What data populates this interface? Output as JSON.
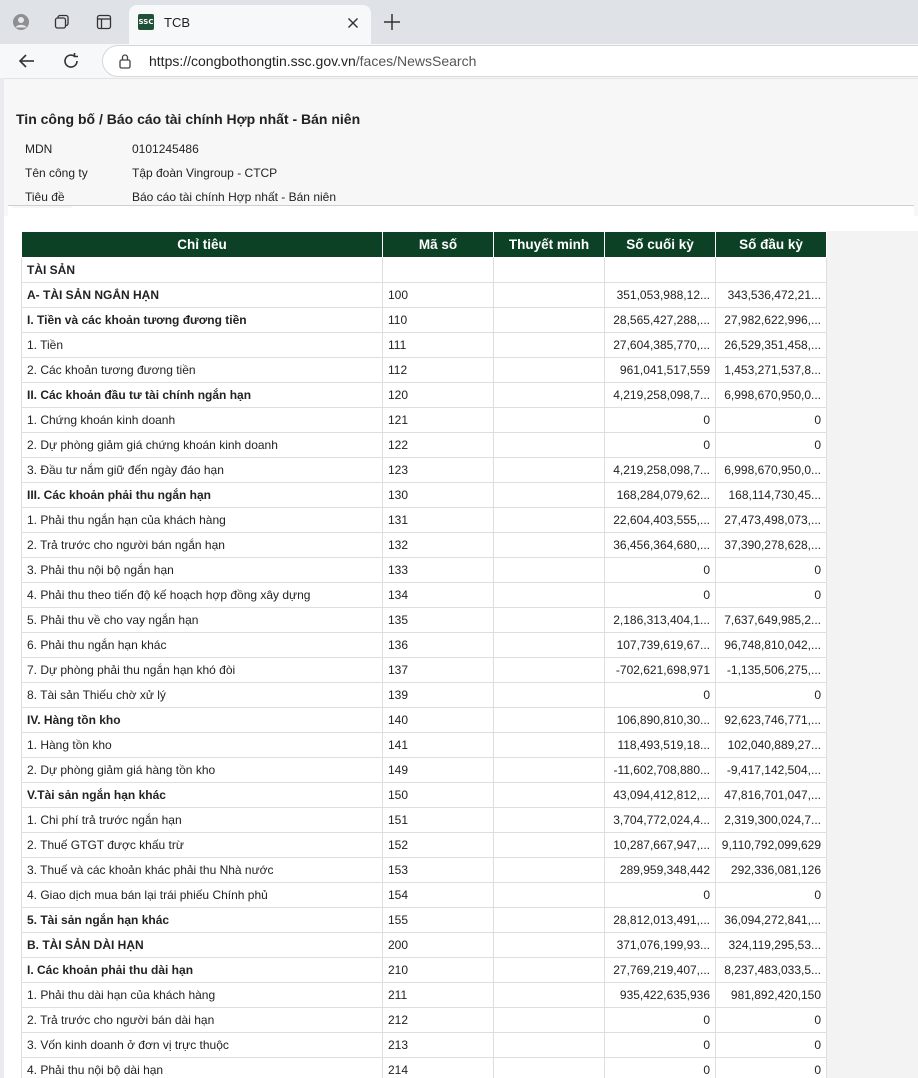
{
  "browser": {
    "tab_title": "TCB",
    "favicon_text": "SSC",
    "url_host": "https://congbothongtin.ssc.gov.vn",
    "url_path": "/faces/NewsSearch"
  },
  "header": {
    "breadcrumb": "Tin công bố / Báo cáo tài chính Hợp nhất - Bán niên",
    "fields": [
      {
        "label": "MDN",
        "value": "0101245486"
      },
      {
        "label": "Tên công ty",
        "value": "Tập đoàn Vingroup - CTCP"
      },
      {
        "label": "Tiêu đề",
        "value": "Báo cáo tài chính Hợp nhất - Bán niên"
      }
    ]
  },
  "table": {
    "columns": [
      "Chỉ tiêu",
      "Mã số",
      "Thuyết minh",
      "Số cuối kỳ",
      "Số đầu kỳ"
    ],
    "rows": [
      {
        "name": "TÀI SẢN",
        "code": "",
        "note": "",
        "end": "",
        "start": "",
        "bold": true
      },
      {
        "name": "A- TÀI SẢN NGẮN HẠN",
        "code": "100",
        "note": "",
        "end": "351,053,988,12...",
        "start": "343,536,472,21...",
        "bold": true
      },
      {
        "name": "I. Tiền và các khoản tương đương tiền",
        "code": "110",
        "note": "",
        "end": "28,565,427,288,...",
        "start": "27,982,622,996,...",
        "bold": true
      },
      {
        "name": "1. Tiền",
        "code": "111",
        "note": "",
        "end": "27,604,385,770,...",
        "start": "26,529,351,458,...",
        "bold": false
      },
      {
        "name": "2. Các khoản tương đương tiền",
        "code": "112",
        "note": "",
        "end": "961,041,517,559",
        "start": "1,453,271,537,8...",
        "bold": false
      },
      {
        "name": "II. Các khoản đầu tư tài chính ngắn hạn",
        "code": "120",
        "note": "",
        "end": "4,219,258,098,7...",
        "start": "6,998,670,950,0...",
        "bold": true
      },
      {
        "name": "1. Chứng khoán kinh doanh",
        "code": "121",
        "note": "",
        "end": "0",
        "start": "0",
        "bold": false
      },
      {
        "name": "2. Dự phòng giảm giá chứng khoán kinh doanh",
        "code": "122",
        "note": "",
        "end": "0",
        "start": "0",
        "bold": false
      },
      {
        "name": "3. Đầu tư nắm giữ đến ngày đáo hạn",
        "code": "123",
        "note": "",
        "end": "4,219,258,098,7...",
        "start": "6,998,670,950,0...",
        "bold": false
      },
      {
        "name": "III. Các khoản phải thu ngắn hạn",
        "code": "130",
        "note": "",
        "end": "168,284,079,62...",
        "start": "168,114,730,45...",
        "bold": true
      },
      {
        "name": "1. Phải thu ngắn hạn của khách hàng",
        "code": "131",
        "note": "",
        "end": "22,604,403,555,...",
        "start": "27,473,498,073,...",
        "bold": false
      },
      {
        "name": "2. Trả trước cho người bán ngắn hạn",
        "code": "132",
        "note": "",
        "end": "36,456,364,680,...",
        "start": "37,390,278,628,...",
        "bold": false
      },
      {
        "name": "3. Phải thu nội bộ ngắn hạn",
        "code": "133",
        "note": "",
        "end": "0",
        "start": "0",
        "bold": false
      },
      {
        "name": "4. Phải thu theo tiến độ kế hoạch hợp đồng xây dựng",
        "code": "134",
        "note": "",
        "end": "0",
        "start": "0",
        "bold": false
      },
      {
        "name": "5. Phải thu về cho vay ngắn hạn",
        "code": "135",
        "note": "",
        "end": "2,186,313,404,1...",
        "start": "7,637,649,985,2...",
        "bold": false
      },
      {
        "name": "6. Phải thu ngắn hạn khác",
        "code": "136",
        "note": "",
        "end": "107,739,619,67...",
        "start": "96,748,810,042,...",
        "bold": false
      },
      {
        "name": "7. Dự phòng phải thu ngắn hạn khó đòi",
        "code": "137",
        "note": "",
        "end": "-702,621,698,971",
        "start": "-1,135,506,275,...",
        "bold": false
      },
      {
        "name": "8. Tài sản Thiếu chờ xử lý",
        "code": "139",
        "note": "",
        "end": "0",
        "start": "0",
        "bold": false
      },
      {
        "name": "IV. Hàng tồn kho",
        "code": "140",
        "note": "",
        "end": "106,890,810,30...",
        "start": "92,623,746,771,...",
        "bold": true
      },
      {
        "name": "1. Hàng tồn kho",
        "code": "141",
        "note": "",
        "end": "118,493,519,18...",
        "start": "102,040,889,27...",
        "bold": false
      },
      {
        "name": "2. Dự phòng giảm giá hàng tồn kho",
        "code": "149",
        "note": "",
        "end": "-11,602,708,880...",
        "start": "-9,417,142,504,...",
        "bold": false
      },
      {
        "name": "V.Tài sản ngắn hạn khác",
        "code": "150",
        "note": "",
        "end": "43,094,412,812,...",
        "start": "47,816,701,047,...",
        "bold": true
      },
      {
        "name": "1. Chi phí trả trước ngắn hạn",
        "code": "151",
        "note": "",
        "end": "3,704,772,024,4...",
        "start": "2,319,300,024,7...",
        "bold": false
      },
      {
        "name": "2. Thuế GTGT được khấu trừ",
        "code": "152",
        "note": "",
        "end": "10,287,667,947,...",
        "start": "9,110,792,099,629",
        "bold": false
      },
      {
        "name": "3. Thuế và các khoản khác phải thu Nhà nước",
        "code": "153",
        "note": "",
        "end": "289,959,348,442",
        "start": "292,336,081,126",
        "bold": false
      },
      {
        "name": "4. Giao dịch mua bán lại trái phiếu Chính phủ",
        "code": "154",
        "note": "",
        "end": "0",
        "start": "0",
        "bold": false
      },
      {
        "name": "5. Tài sản ngắn hạn khác",
        "code": "155",
        "note": "",
        "end": "28,812,013,491,...",
        "start": "36,094,272,841,...",
        "bold": true
      },
      {
        "name": "B. TÀI SẢN DÀI HẠN",
        "code": "200",
        "note": "",
        "end": "371,076,199,93...",
        "start": "324,119,295,53...",
        "bold": true
      },
      {
        "name": "I. Các khoản phải thu dài hạn",
        "code": "210",
        "note": "",
        "end": "27,769,219,407,...",
        "start": "8,237,483,033,5...",
        "bold": true
      },
      {
        "name": "1. Phải thu dài hạn của khách hàng",
        "code": "211",
        "note": "",
        "end": "935,422,635,936",
        "start": "981,892,420,150",
        "bold": false
      },
      {
        "name": "2. Trả trước cho người bán dài hạn",
        "code": "212",
        "note": "",
        "end": "0",
        "start": "0",
        "bold": false
      },
      {
        "name": "3. Vốn kinh doanh ở đơn vị trực thuộc",
        "code": "213",
        "note": "",
        "end": "0",
        "start": "0",
        "bold": false
      },
      {
        "name": "4. Phải thu nội bộ dài hạn",
        "code": "214",
        "note": "",
        "end": "0",
        "start": "0",
        "bold": false
      }
    ]
  },
  "colors": {
    "header_bg": "#0d4126",
    "accent": "#1f5137"
  }
}
